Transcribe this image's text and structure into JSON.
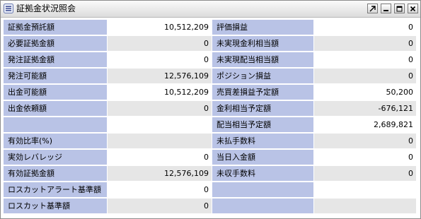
{
  "window": {
    "title": "証拠金状況照会",
    "buttons": [
      "restore",
      "minimize",
      "maximize",
      "close"
    ]
  },
  "rows": [
    {
      "left_label": "証拠金預託額",
      "left_value": "10,512,209",
      "right_label": "評価損益",
      "right_value": "0"
    },
    {
      "left_label": "必要証拠金額",
      "left_value": "0",
      "right_label": "未実現金利相当額",
      "right_value": "0"
    },
    {
      "left_label": "発注証拠金額",
      "left_value": "0",
      "right_label": "未実現配当相当額",
      "right_value": "0"
    },
    {
      "left_label": "発注可能額",
      "left_value": "12,576,109",
      "right_label": "ポジション損益",
      "right_value": "0"
    },
    {
      "left_label": "出金可能額",
      "left_value": "10,512,209",
      "right_label": "売買差損益予定額",
      "right_value": "50,200"
    },
    {
      "left_label": "出金依頼額",
      "left_value": "0",
      "right_label": "金利相当予定額",
      "right_value": "-676,121"
    },
    {
      "left_label": "",
      "left_value": "",
      "right_label": "配当相当予定額",
      "right_value": "2,689,821"
    },
    {
      "left_label": "有効比率(%)",
      "left_value": "",
      "right_label": "未払手数料",
      "right_value": "0"
    },
    {
      "left_label": "実効レバレッジ",
      "left_value": "0",
      "right_label": "当日入金額",
      "right_value": "0"
    },
    {
      "left_label": "有効証拠金額",
      "left_value": "12,576,109",
      "right_label": "未収手数料",
      "right_value": "0"
    },
    {
      "left_label": "ロスカットアラート基準額",
      "left_value": "0",
      "right_label": "",
      "right_value": ""
    },
    {
      "left_label": "ロスカット基準額",
      "left_value": "0",
      "right_label": "",
      "right_value": ""
    }
  ]
}
